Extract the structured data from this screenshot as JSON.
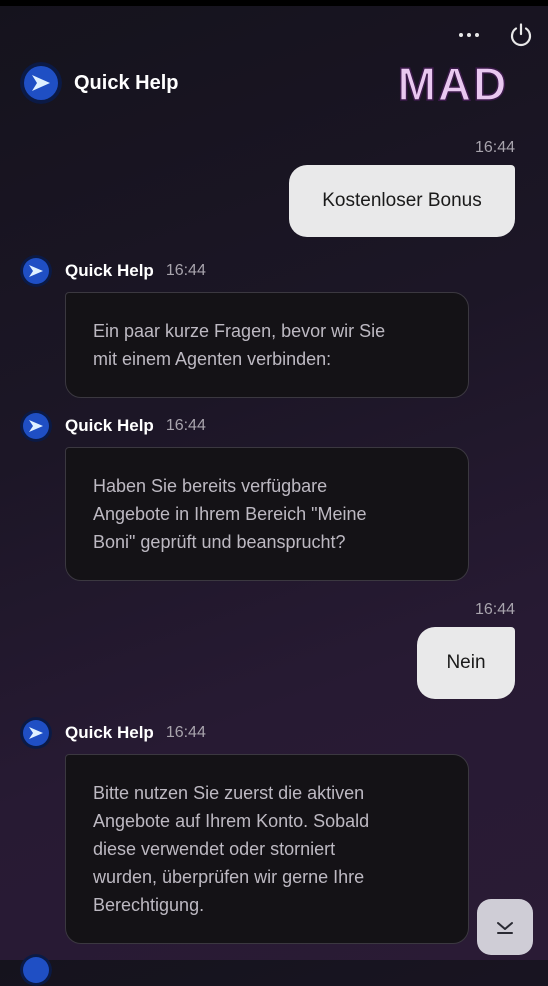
{
  "header": {
    "title": "Quick Help",
    "brand_logo_text": "MAD",
    "menu_icon": "more-dots-icon",
    "power_icon": "power-icon"
  },
  "colors": {
    "user_bubble": "#e9e9ea",
    "bot_bubble": "#141216",
    "bot_border": "#3b3840",
    "accent_blue": "#2f7ff0",
    "logo_pink": "#e9c8f0"
  },
  "messages": [
    {
      "sender": "user",
      "time": "16:44",
      "text": "Kostenloser Bonus"
    },
    {
      "sender": "bot",
      "name": "Quick Help",
      "time": "16:44",
      "lines": [
        "Ein paar kurze Fragen, bevor wir Sie",
        "mit einem Agenten verbinden:"
      ]
    },
    {
      "sender": "bot",
      "name": "Quick Help",
      "time": "16:44",
      "lines": [
        "Haben Sie bereits verfügbare",
        "Angebote in Ihrem Bereich \"Meine",
        "Boni\" geprüft und beansprucht?"
      ]
    },
    {
      "sender": "user",
      "time": "16:44",
      "text": "Nein"
    },
    {
      "sender": "bot",
      "name": "Quick Help",
      "time": "16:44",
      "lines": [
        "Bitte nutzen Sie zuerst die aktiven",
        "Angebote auf Ihrem Konto. Sobald",
        "diese verwendet oder storniert",
        "wurden, überprüfen wir gerne Ihre",
        "Berechtigung."
      ]
    }
  ],
  "scroll_button_icon": "chevron-down-icon"
}
